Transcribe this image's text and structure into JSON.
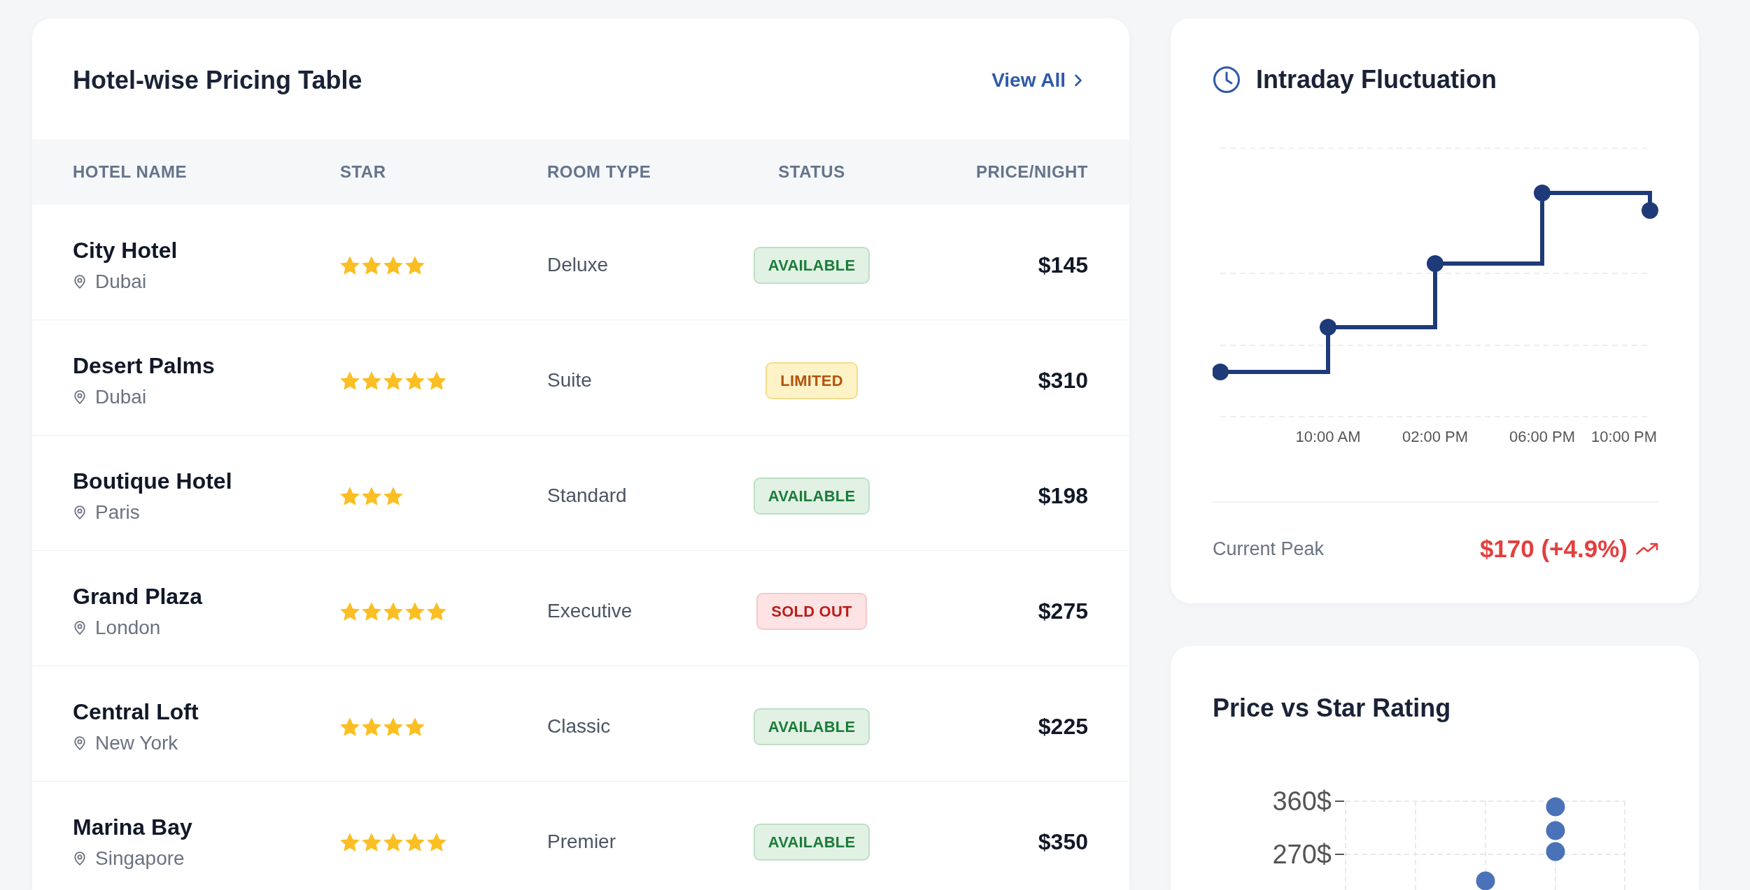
{
  "pricing_table": {
    "title": "Hotel-wise Pricing Table",
    "view_all": "View All",
    "columns": [
      "HOTEL NAME",
      "STAR",
      "ROOM TYPE",
      "STATUS",
      "PRICE/NIGHT"
    ],
    "rows": [
      {
        "name": "City Hotel",
        "location": "Dubai",
        "stars": 4,
        "room_type": "Deluxe",
        "status": {
          "label": "AVAILABLE",
          "kind": "available"
        },
        "price": "$145"
      },
      {
        "name": "Desert Palms",
        "location": "Dubai",
        "stars": 5,
        "room_type": "Suite",
        "status": {
          "label": "LIMITED",
          "kind": "limited"
        },
        "price": "$310"
      },
      {
        "name": "Boutique Hotel",
        "location": "Paris",
        "stars": 3,
        "room_type": "Standard",
        "status": {
          "label": "AVAILABLE",
          "kind": "available"
        },
        "price": "$198"
      },
      {
        "name": "Grand Plaza",
        "location": "London",
        "stars": 5,
        "room_type": "Executive",
        "status": {
          "label": "SOLD OUT",
          "kind": "sold_out"
        },
        "price": "$275"
      },
      {
        "name": "Central Loft",
        "location": "New York",
        "stars": 4,
        "room_type": "Classic",
        "status": {
          "label": "AVAILABLE",
          "kind": "available"
        },
        "price": "$225"
      },
      {
        "name": "Marina Bay",
        "location": "Singapore",
        "stars": 5,
        "room_type": "Premier",
        "status": {
          "label": "AVAILABLE",
          "kind": "available"
        },
        "price": "$350"
      }
    ]
  },
  "intraday_fluctuation": {
    "title": "Intraday Fluctuation",
    "x_labels": [
      "10:00 AM",
      "02:00 PM",
      "06:00 PM",
      "10:00 PM"
    ],
    "peak_label": "Current Peak",
    "peak_value": "$170 (+4.9%)"
  },
  "price_vs_star": {
    "title": "Price vs Star Rating",
    "y_labels": [
      "360$",
      "270$"
    ]
  }
}
